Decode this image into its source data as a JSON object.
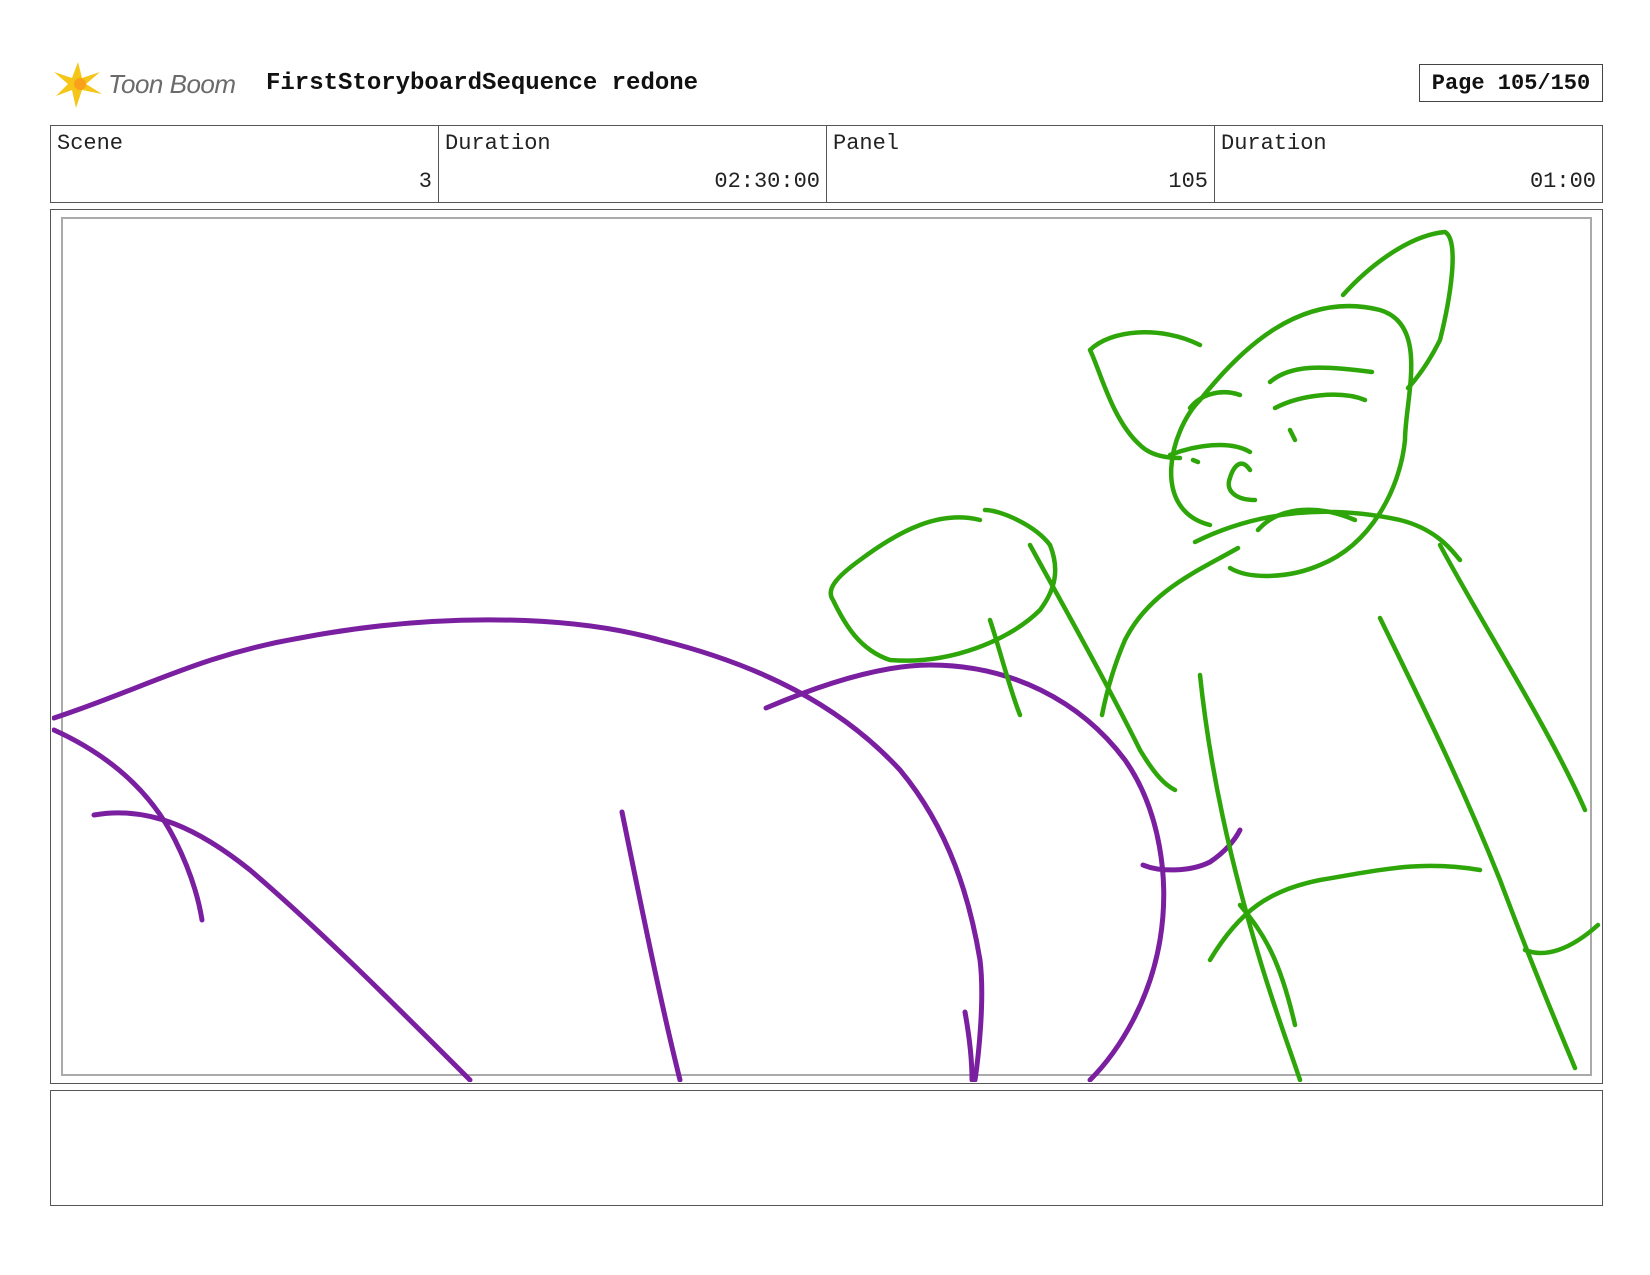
{
  "header": {
    "logo_text": "Toon Boom",
    "title": "FirstStoryboardSequence redone",
    "page_label": "Page 105/150"
  },
  "info": {
    "scene_label": "Scene",
    "scene_value": "3",
    "scene_duration_label": "Duration",
    "scene_duration_value": "02:30:00",
    "panel_label": "Panel",
    "panel_value": "105",
    "panel_duration_label": "Duration",
    "panel_duration_value": "01:00"
  },
  "colors": {
    "purple_stroke": "#7a1fa0",
    "green_stroke": "#2ea60a",
    "logo_yellow": "#f5c518"
  },
  "notes": {
    "text": ""
  }
}
